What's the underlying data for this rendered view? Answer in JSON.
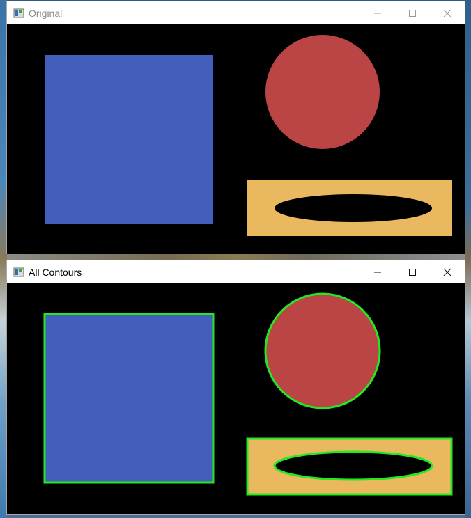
{
  "windows": [
    {
      "title": "Original",
      "icon": "opencv-window-icon",
      "controls": [
        "minimize-icon",
        "maximize-icon",
        "close-icon"
      ],
      "shapes": [
        "blue-square",
        "red-circle",
        "yellow-rectangle",
        "black-ellipse"
      ],
      "contours": false
    },
    {
      "title": "All Contours",
      "icon": "opencv-window-icon",
      "controls": [
        "minimize-icon",
        "maximize-icon",
        "close-icon"
      ],
      "shapes": [
        "blue-square",
        "red-circle",
        "yellow-rectangle",
        "black-ellipse"
      ],
      "contours": true
    }
  ],
  "colors": {
    "canvas_background": "#000000",
    "square": "#435ebb",
    "circle": "#bb4545",
    "rectangle": "#e9b85f",
    "ellipse": "#000000",
    "contour": "#22e922",
    "titlebar": "#ffffff"
  }
}
